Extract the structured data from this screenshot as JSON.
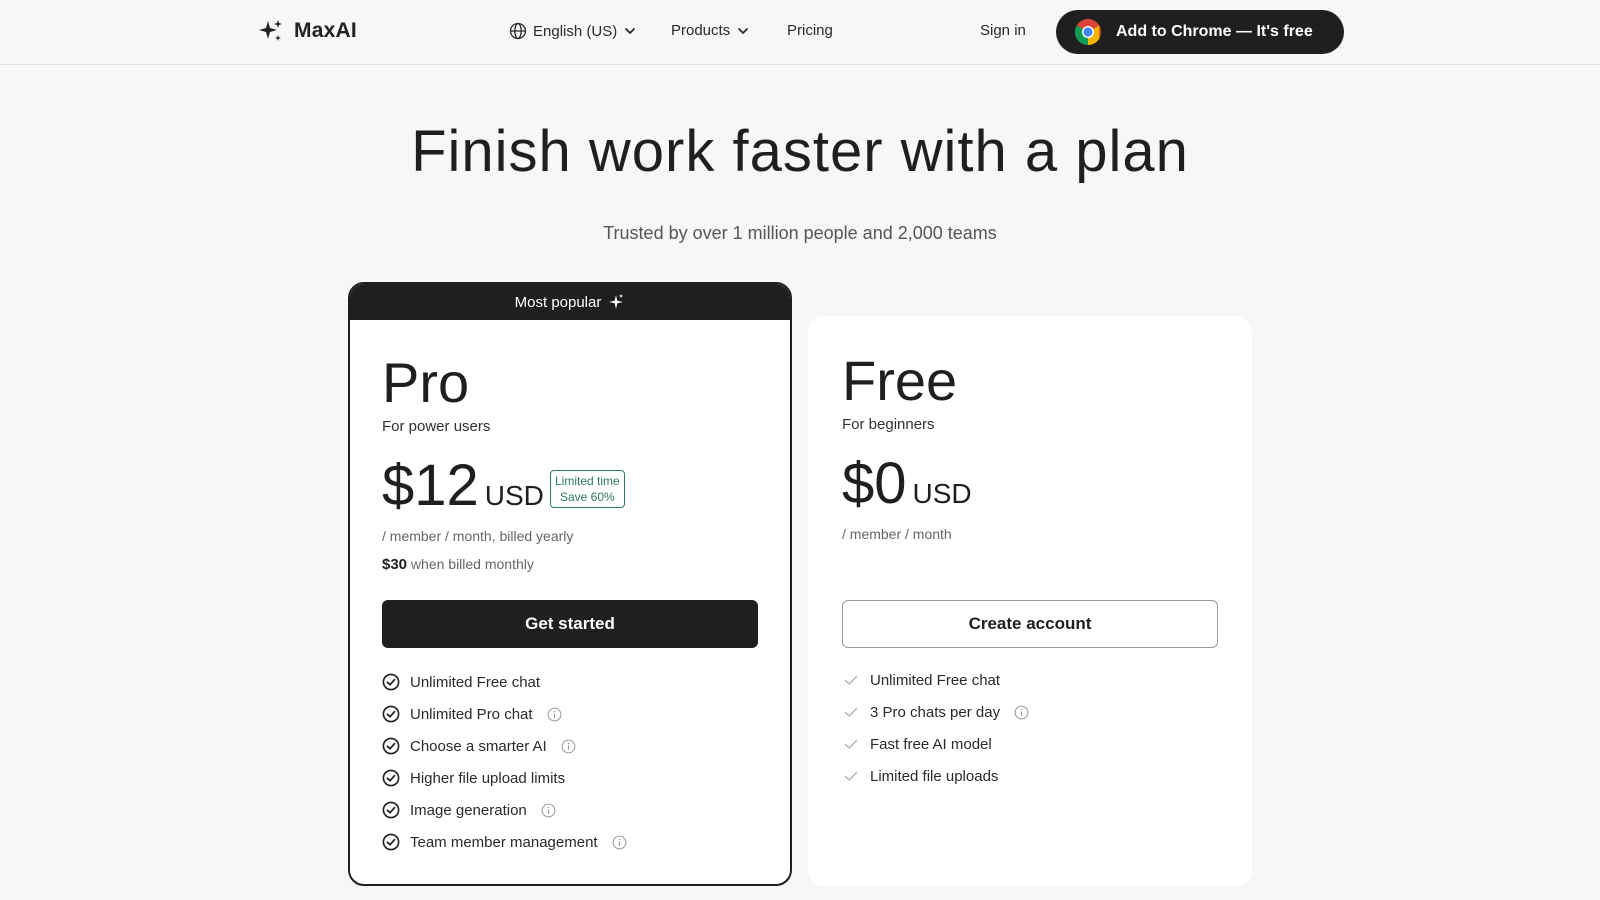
{
  "header": {
    "brand": "MaxAI",
    "language": "English (US)",
    "products": "Products",
    "pricing": "Pricing",
    "sign_in": "Sign in",
    "cta": "Add to Chrome — It's free"
  },
  "hero": {
    "title": "Finish work faster with a plan",
    "subtitle": "Trusted by over 1 million people and 2,000 teams"
  },
  "plans": {
    "pro": {
      "ribbon": "Most popular",
      "name": "Pro",
      "desc": "For power users",
      "price": "$12",
      "currency": "USD",
      "badge_line1": "Limited time",
      "badge_line2": "Save 60%",
      "billing": "/ member / month, billed yearly",
      "monthly_price": "$30",
      "monthly_text": "when billed monthly",
      "button": "Get started",
      "features": [
        {
          "label": "Unlimited Free chat",
          "info": false
        },
        {
          "label": "Unlimited Pro chat",
          "info": true
        },
        {
          "label": "Choose a smarter AI",
          "info": true
        },
        {
          "label": "Higher file upload limits",
          "info": false
        },
        {
          "label": "Image generation",
          "info": true
        },
        {
          "label": "Team member management",
          "info": true
        }
      ]
    },
    "free": {
      "name": "Free",
      "desc": "For beginners",
      "price": "$0",
      "currency": "USD",
      "billing": "/ member / month",
      "button": "Create account",
      "features": [
        {
          "label": "Unlimited Free chat",
          "info": false
        },
        {
          "label": "3 Pro chats per day",
          "info": true
        },
        {
          "label": "Fast free AI model",
          "info": false
        },
        {
          "label": "Limited file uploads",
          "info": false
        }
      ]
    }
  },
  "colors": {
    "dark": "#1f1f1f",
    "page_bg": "#f7f7f7",
    "badge_green": "#2d7a5c"
  },
  "icons": {
    "logo": "sparkle-icon",
    "language": "globe-icon",
    "dropdown": "chevron-down-icon",
    "cta": "chrome-icon",
    "ribbon": "sparkle-icon",
    "pro_feature": "circle-check-icon",
    "free_feature": "check-icon",
    "feature_info": "info-icon"
  }
}
